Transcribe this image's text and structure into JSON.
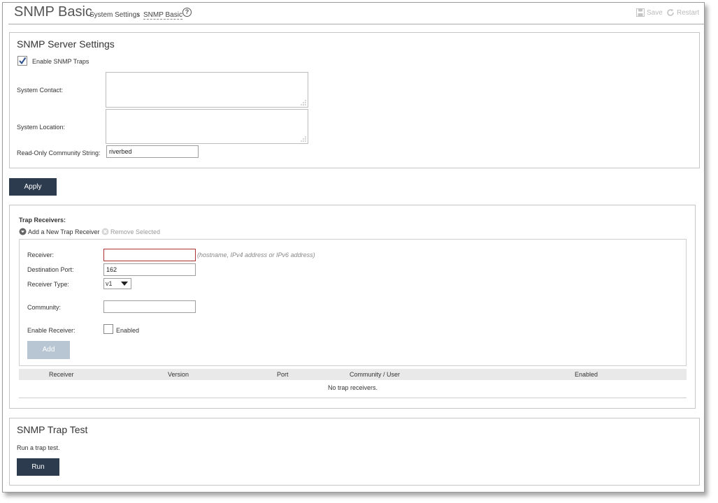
{
  "header": {
    "title": "SNMP Basic",
    "breadcrumb_parent": "System Settings",
    "breadcrumb_separator": "›",
    "breadcrumb_current": "SNMP Basic",
    "help_glyph": "?",
    "save_label": "Save",
    "restart_label": "Restart"
  },
  "server_settings": {
    "title": "SNMP Server Settings",
    "enable_traps_label": "Enable SNMP Traps",
    "enable_traps_checked": true,
    "system_contact_label": "System Contact:",
    "system_contact_value": "",
    "system_location_label": "System Location:",
    "system_location_value": "",
    "community_label": "Read-Only Community String:",
    "community_value": "riverbed"
  },
  "apply_label": "Apply",
  "trap_receivers": {
    "title": "Trap Receivers:",
    "add_new_label": "Add a New Trap Receiver",
    "remove_label": "Remove Selected",
    "form": {
      "receiver_label": "Receiver:",
      "receiver_value": "",
      "receiver_hint": "(hostname, IPv4 address or IPv6 address)",
      "port_label": "Destination Port:",
      "port_value": "162",
      "type_label": "Receiver Type:",
      "type_value": "v1",
      "community_label": "Community:",
      "community_value": "",
      "enable_label": "Enable Receiver:",
      "enabled_text": "Enabled",
      "add_label": "Add"
    },
    "table": {
      "columns": [
        "Receiver",
        "Version",
        "Port",
        "Community / User",
        "Enabled"
      ],
      "empty_message": "No trap receivers."
    }
  },
  "trap_test": {
    "title": "SNMP Trap Test",
    "description": "Run a trap test.",
    "run_label": "Run"
  },
  "colors": {
    "button_dark": "#2c3b4e",
    "button_disabled": "#b8c6d4",
    "error_border": "#aa3333"
  }
}
